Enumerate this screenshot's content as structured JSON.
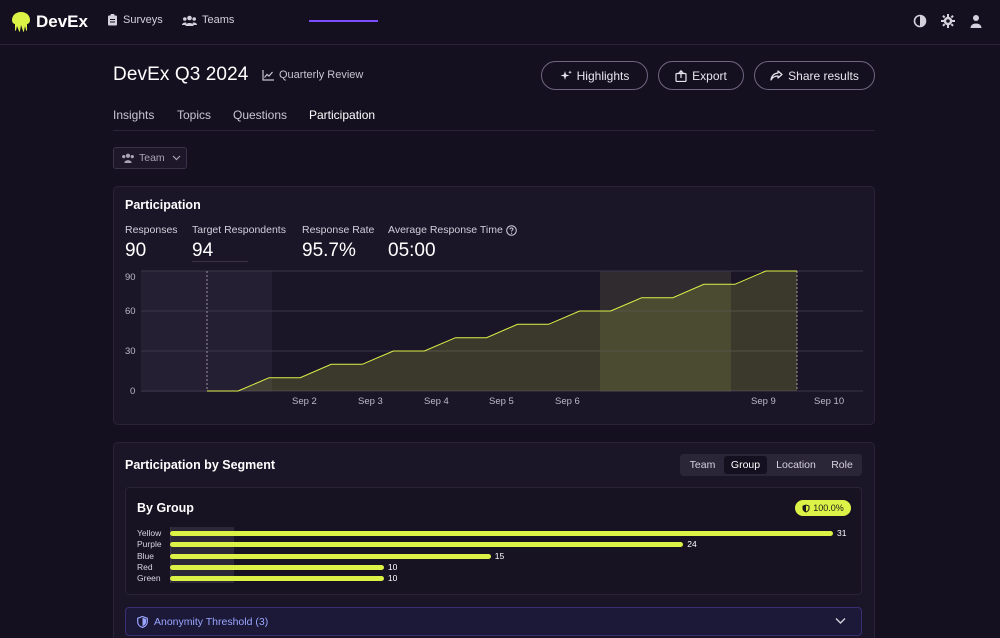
{
  "nav": {
    "brand": "DevEx",
    "links": [
      {
        "label": "Surveys",
        "icon": "clipboard-icon"
      },
      {
        "label": "Teams",
        "icon": "users-icon"
      }
    ],
    "icons": [
      "contrast-icon",
      "gear-icon",
      "user-icon"
    ]
  },
  "header": {
    "title": "DevEx Q3 2024",
    "subtitle": "Quarterly Review",
    "buttons": {
      "highlights": "Highlights",
      "export": "Export",
      "share": "Share results"
    }
  },
  "tabs": [
    "Insights",
    "Topics",
    "Questions",
    "Participation"
  ],
  "active_tab": "Participation",
  "filter": {
    "label": "Team"
  },
  "participation": {
    "title": "Participation",
    "stats": [
      {
        "label": "Responses",
        "value": "90"
      },
      {
        "label": "Target Respondents",
        "value": "94"
      },
      {
        "label": "Response Rate",
        "value": "95.7%"
      },
      {
        "label": "Average Response Time",
        "value": "05:00"
      }
    ]
  },
  "chart_data": {
    "type": "area",
    "y_ticks": [
      "90",
      "60",
      "30",
      "0"
    ],
    "x_ticks": [
      "Sep 2",
      "Sep 3",
      "Sep 4",
      "Sep 5",
      "Sep 6",
      "Sep 9",
      "Sep 10"
    ],
    "ylim": [
      0,
      90
    ],
    "grid": true,
    "series": [
      {
        "values": [
          0,
          0,
          10,
          10,
          20,
          20,
          30,
          30,
          40,
          40,
          50,
          50,
          60,
          60,
          70,
          70,
          80,
          80,
          90,
          90
        ]
      }
    ]
  },
  "segment": {
    "title": "Participation by Segment",
    "options": [
      "Team",
      "Group",
      "Location",
      "Role"
    ],
    "active": "Group",
    "subtitle": "By Group",
    "badge": "100.0%",
    "bars": [
      {
        "label": "Yellow",
        "value": 31
      },
      {
        "label": "Purple",
        "value": 24
      },
      {
        "label": "Blue",
        "value": 15
      },
      {
        "label": "Red",
        "value": 10
      },
      {
        "label": "Green",
        "value": 10
      }
    ],
    "max": 31
  },
  "anonymity": {
    "label": "Anonymity Threshold (3)"
  },
  "colors": {
    "accent": "#ddf247",
    "tab_underline": "#7c4dff",
    "background": "#15101f"
  }
}
